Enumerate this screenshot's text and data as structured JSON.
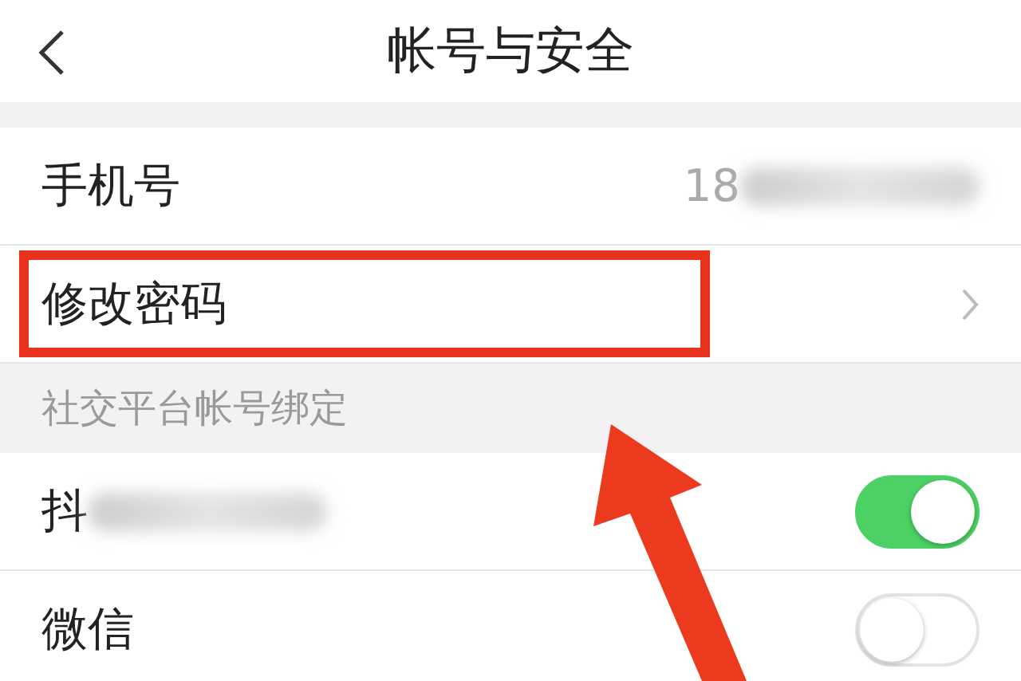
{
  "header": {
    "title": "帐号与安全"
  },
  "rows": [
    {
      "kind": "value",
      "label": "手机号",
      "value": "18",
      "highlighted": false
    },
    {
      "kind": "link",
      "label": "修改密码",
      "highlighted": true
    }
  ],
  "section": {
    "title": "社交平台帐号绑定"
  },
  "bindings": [
    {
      "label": "抖",
      "on": true,
      "redacted": true
    },
    {
      "label": "微信",
      "on": false,
      "redacted": false
    }
  ]
}
